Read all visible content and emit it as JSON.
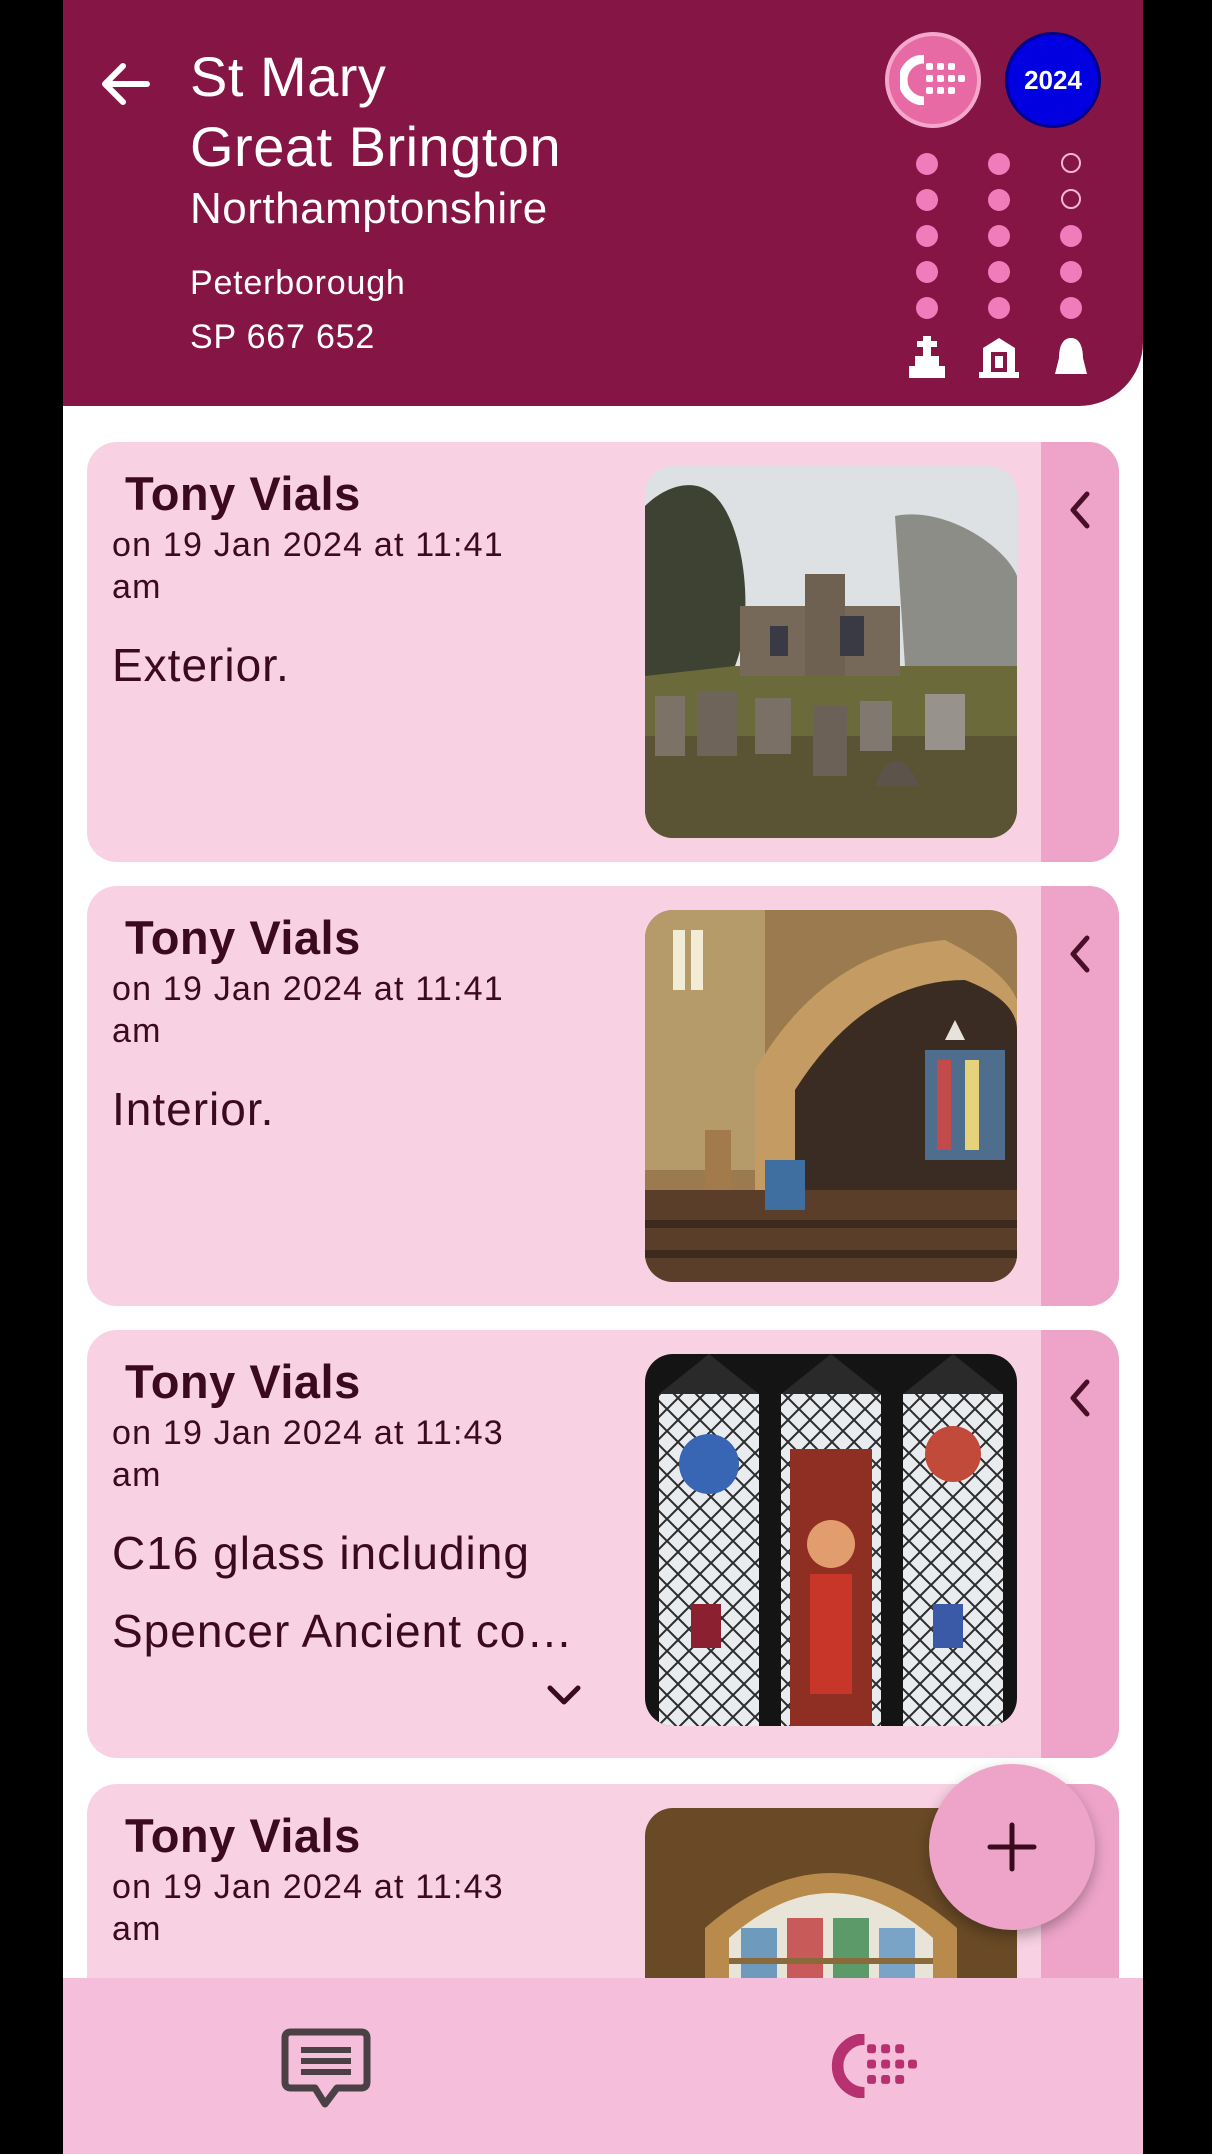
{
  "header": {
    "church_name": "St Mary",
    "place": "Great Brington",
    "county": "Northamptonshire",
    "diocese": "Peterborough",
    "grid_ref": "SP 667 652",
    "year_badge": "2024",
    "back_icon": "arrow-left-icon",
    "logo_icon": "dashboard-logo-icon",
    "status_columns": [
      {
        "icon": "grave-icon",
        "filled": 5
      },
      {
        "icon": "church-building-icon",
        "filled": 5
      },
      {
        "icon": "bell-icon",
        "filled": 3
      }
    ]
  },
  "posts": [
    {
      "author": "Tony Vials",
      "timestamp": "on 19 Jan 2024 at 11:41 am",
      "caption": "Exterior.",
      "photo": "church exterior with graveyard"
    },
    {
      "author": "Tony Vials",
      "timestamp": "on 19 Jan 2024 at 11:41 am",
      "caption": "Interior.",
      "photo": "church interior nave with arches"
    },
    {
      "author": "Tony Vials",
      "timestamp": "on 19 Jan 2024 at 11:43 am",
      "caption": "C16 glass including Spencer Ancient co…",
      "photo": "stained glass window"
    },
    {
      "author": "Tony Vials",
      "timestamp": "on 19 Jan 2024 at 11:43 am",
      "caption": "",
      "photo": "stained glass window"
    }
  ],
  "fab": {
    "icon": "plus-icon"
  },
  "bottom_nav": [
    {
      "icon": "message-icon"
    },
    {
      "icon": "dashboard-logo-icon"
    }
  ],
  "colors": {
    "header_bg": "#851545",
    "card_bg": "#f8d1e3",
    "card_side": "#eea4c9",
    "bottom_bar": "#f5bedb",
    "dot_filled": "#f07cbb",
    "year_badge": "#0000e0"
  }
}
